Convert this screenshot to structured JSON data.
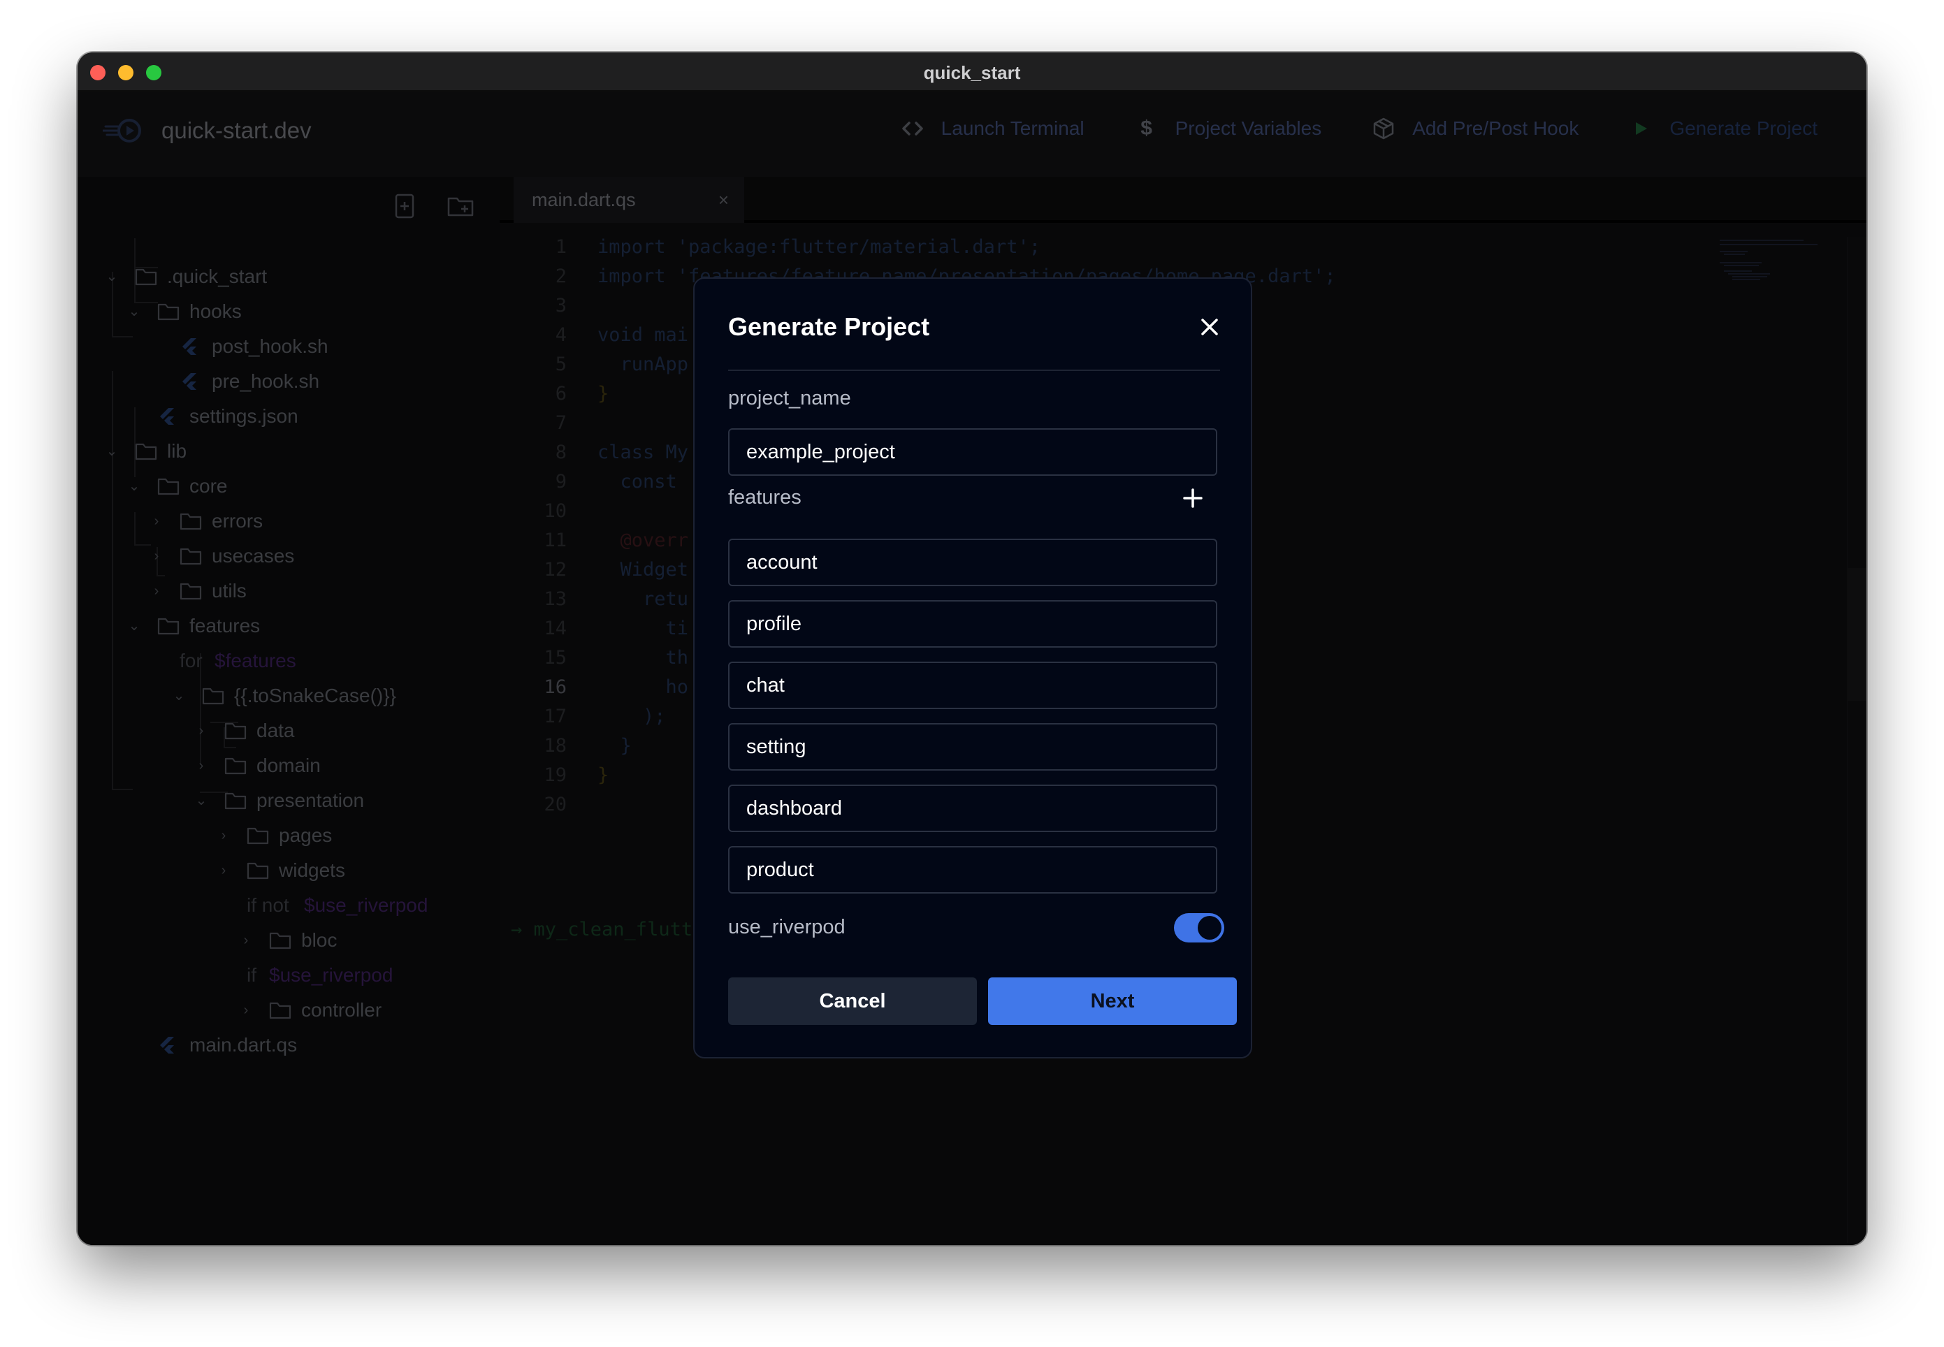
{
  "window": {
    "title": "quick_start"
  },
  "app": {
    "brand": "quick-start.dev"
  },
  "toolbar": {
    "items": [
      {
        "label": "Launch Terminal",
        "icon": "code-icon"
      },
      {
        "label": "Project Variables",
        "icon": "dollar-icon"
      },
      {
        "label": "Add Pre/Post Hook",
        "icon": "box-icon"
      },
      {
        "label": "Generate Project",
        "icon": "play-icon"
      }
    ]
  },
  "tree": {
    "quick_start": ".quick_start",
    "hooks": "hooks",
    "post_hook": "post_hook.sh",
    "pre_hook": "pre_hook.sh",
    "settings": "settings.json",
    "lib": "lib",
    "core": "core",
    "errors": "errors",
    "usecases": "usecases",
    "utils": "utils",
    "features": "features",
    "for_kw": "for",
    "for_var": "$features",
    "snake": "{{.toSnakeCase()}}",
    "data": "data",
    "domain": "domain",
    "presentation": "presentation",
    "pages": "pages",
    "widgets": "widgets",
    "ifnot_kw": "if not",
    "ifnot_var": "$use_riverpod",
    "bloc": "bloc",
    "if_kw": "if",
    "if_var": "$use_riverpod",
    "controller": "controller",
    "main": "main.dart.qs"
  },
  "editor": {
    "tab": "main.dart.qs",
    "lines": [
      {
        "n": "1",
        "t": "import 'package:flutter/material.dart';"
      },
      {
        "n": "2",
        "t": "import 'features/feature_name/presentation/pages/home_page.dart';"
      },
      {
        "n": "3",
        "t": ""
      },
      {
        "n": "4",
        "t": "void mai"
      },
      {
        "n": "5",
        "t": "  runApp"
      },
      {
        "n": "6",
        "t": "}"
      },
      {
        "n": "7",
        "t": ""
      },
      {
        "n": "8",
        "t": "class My"
      },
      {
        "n": "9",
        "t": "  const "
      },
      {
        "n": "10",
        "t": ""
      },
      {
        "n": "11",
        "t": "  @overr"
      },
      {
        "n": "12",
        "t": "  Widget"
      },
      {
        "n": "13",
        "t": "    retu"
      },
      {
        "n": "14",
        "t": "      ti"
      },
      {
        "n": "15",
        "t": "      th"
      },
      {
        "n": "16",
        "t": "      ho"
      },
      {
        "n": "17",
        "t": "    );"
      },
      {
        "n": "18",
        "t": "  }"
      },
      {
        "n": "19",
        "t": "}"
      },
      {
        "n": "20",
        "t": ""
      }
    ],
    "terminal": "→  my_clean_flutt"
  },
  "modal": {
    "title": "Generate Project",
    "project_name_label": "project_name",
    "project_name_value": "example_project",
    "features_label": "features",
    "features": [
      "account",
      "profile",
      "chat",
      "setting",
      "dashboard",
      "product"
    ],
    "use_riverpod_label": "use_riverpod",
    "use_riverpod_value": true,
    "cancel": "Cancel",
    "next": "Next"
  },
  "colors": {
    "accent": "#4178ea",
    "modal_bg": "#020716",
    "toggle_on": "#3f73e6"
  }
}
